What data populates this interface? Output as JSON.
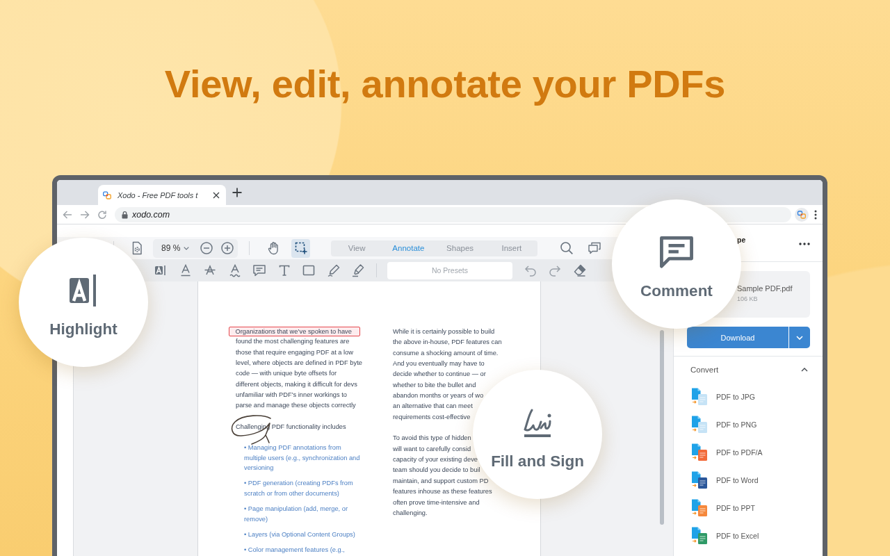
{
  "headline": "View, edit, annotate your PDFs",
  "browser": {
    "tab": {
      "title": "Xodo - Free PDF tools t"
    },
    "address": "xodo.com"
  },
  "toolbar": {
    "zoom": "89 %",
    "pan_tool": {
      "selected": false
    },
    "select_tool": {
      "selected": true
    },
    "modes": [
      {
        "label": "View",
        "selected": false
      },
      {
        "label": "Annotate",
        "selected": true
      },
      {
        "label": "Shapes",
        "selected": false
      },
      {
        "label": "Insert",
        "selected": false
      }
    ]
  },
  "annotation_toolbar": {
    "presets": {
      "placeholder": "No Presets"
    }
  },
  "document": {
    "columns": [
      [
        {
          "kind": "paragraph",
          "ink_circle": false,
          "highlight": "Organizations that we’ve spoken to have",
          "lines": [
            "found the most challenging features are",
            "those that require engaging PDF at a low",
            "level, where objects are defined in PDF byte",
            "code — with unique byte offsets for",
            "different objects, making it difficult for devs",
            "unfamiliar with PDF’s inner workings to",
            "parse and manage these objects correctly"
          ]
        },
        {
          "kind": "paragraph",
          "ink_circle": true,
          "lines": [
            "Challenging PDF functionality includes"
          ]
        },
        {
          "kind": "bullet",
          "ink_circle": false,
          "lines": [
            "• Managing PDF annotations from",
            "multiple users (e.g., synchronization and",
            "versioning"
          ]
        },
        {
          "kind": "bullet",
          "ink_circle": false,
          "lines": [
            "• PDF generation (creating PDFs from",
            "scratch or from other documents)"
          ]
        },
        {
          "kind": "bullet",
          "ink_circle": false,
          "lines": [
            "• Page manipulation (add, merge, or",
            "remove)"
          ]
        },
        {
          "kind": "bullet",
          "ink_circle": false,
          "lines": [
            "• Layers (via Optional Content Groups)"
          ]
        },
        {
          "kind": "bullet",
          "ink_circle": false,
          "lines": [
            "• Color management features (e.g.,"
          ]
        }
      ],
      [
        {
          "kind": "paragraph",
          "ink_circle": false,
          "lines": [
            "While it is certainly possible to build",
            "the above in-house, PDF features can",
            "consume a shocking amount of time.",
            "And you eventually may have to",
            "decide whether to continue — or",
            "whether to bite the bullet and",
            "abandon months or years of wo",
            "an alternative that can meet",
            "requirements cost-effective"
          ]
        },
        {
          "kind": "paragraph",
          "ink_circle": false,
          "lines": [
            "To avoid this type of hidden",
            "will want to carefully consid",
            "capacity of your existing deve",
            "team should you decide to buil",
            "maintain, and support custom PD",
            "features inhouse as these features",
            "often prove time-intensive and",
            "challenging."
          ]
        }
      ]
    ]
  },
  "side_panel": {
    "title": "pe",
    "file": {
      "name": "Sample PDF.pdf",
      "size": "106 KB"
    },
    "download": {
      "label": "Download"
    },
    "convert": {
      "title": "Convert",
      "expanded": true,
      "items": [
        {
          "label": "PDF to JPG",
          "color": "#c6e3f6"
        },
        {
          "label": "PDF to PNG",
          "color": "#c6e3f6"
        },
        {
          "label": "PDF to PDF/A",
          "color": "#f26b3a"
        },
        {
          "label": "PDF to Word",
          "color": "#2b579a"
        },
        {
          "label": "PDF to PPT",
          "color": "#f5883c"
        },
        {
          "label": "PDF to Excel",
          "color": "#2f9a67"
        }
      ]
    }
  },
  "callouts": [
    {
      "kind": "highlight",
      "label": "Highlight"
    },
    {
      "kind": "comment",
      "label": "Comment"
    },
    {
      "kind": "sign",
      "label": "Fill and Sign"
    }
  ]
}
